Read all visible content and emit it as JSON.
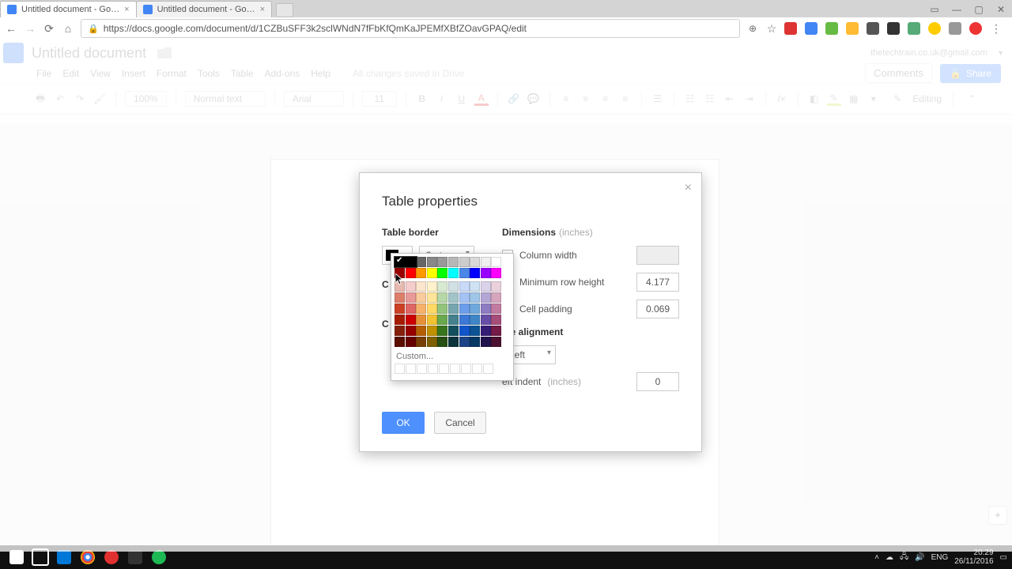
{
  "browser": {
    "tabs": [
      {
        "title": "Untitled document - Go…"
      },
      {
        "title": "Untitled document - Go…"
      }
    ],
    "url": "https://docs.google.com/document/d/1CZBuSFF3k2sclWNdN7fFbKfQmKaJPEMfXBfZOavGPAQ/edit"
  },
  "docs": {
    "title": "Untitled document",
    "account": "thetechtrain.co.uk@gmail.com",
    "comments": "Comments",
    "share": "Share",
    "menus": [
      "File",
      "Edit",
      "View",
      "Insert",
      "Format",
      "Tools",
      "Table",
      "Add-ons",
      "Help"
    ],
    "saved": "All changes saved in Drive",
    "zoom": "100%",
    "style": "Normal text",
    "font": "Arial",
    "size": "11",
    "editing": "Editing"
  },
  "dialog": {
    "title": "Table properties",
    "close": "×",
    "left": {
      "section": "Table border",
      "pt": "3 pt",
      "cell_bg_label_initial": "C",
      "vert_label_initial": "C"
    },
    "right": {
      "section": "Dimensions",
      "hint": "(inches)",
      "col_width": "Column width",
      "min_row": "Minimum row height",
      "min_row_val": "4.177",
      "cell_pad": "Cell padding",
      "cell_pad_val": "0.069",
      "align_section": "ble alignment",
      "align_val": "Left",
      "indent_label": "eft indent",
      "indent_hint": "(inches)",
      "indent_val": "0"
    },
    "ok": "OK",
    "cancel": "Cancel"
  },
  "picker": {
    "custom": "Custom...",
    "colors": {
      "grays": [
        "#000000",
        "#444444",
        "#666666",
        "#888888",
        "#999999",
        "#b7b7b7",
        "#cccccc",
        "#d9d9d9",
        "#efefef",
        "#ffffff"
      ],
      "brights": [
        "#980000",
        "#ff0000",
        "#ff9900",
        "#ffff00",
        "#00ff00",
        "#00ffff",
        "#4a86e8",
        "#0000ff",
        "#9900ff",
        "#ff00ff"
      ],
      "shades": [
        [
          "#e6b8af",
          "#f4cccc",
          "#fce5cd",
          "#fff2cc",
          "#d9ead3",
          "#d0e0e3",
          "#c9daf8",
          "#cfe2f3",
          "#d9d2e9",
          "#ead1dc"
        ],
        [
          "#dd7e6b",
          "#ea9999",
          "#f9cb9c",
          "#ffe599",
          "#b6d7a8",
          "#a2c4c9",
          "#a4c2f4",
          "#9fc5e8",
          "#b4a7d6",
          "#d5a6bd"
        ],
        [
          "#cc4125",
          "#e06666",
          "#f6b26b",
          "#ffd966",
          "#93c47d",
          "#76a5af",
          "#6d9eeb",
          "#6fa8dc",
          "#8e7cc3",
          "#c27ba0"
        ],
        [
          "#a61c00",
          "#cc0000",
          "#e69138",
          "#f1c232",
          "#6aa84f",
          "#45818e",
          "#3c78d8",
          "#3d85c6",
          "#674ea7",
          "#a64d79"
        ],
        [
          "#85200c",
          "#990000",
          "#b45f06",
          "#bf9000",
          "#38761d",
          "#134f5c",
          "#1155cc",
          "#0b5394",
          "#351c75",
          "#741b47"
        ],
        [
          "#5b0f00",
          "#660000",
          "#783f04",
          "#7f6000",
          "#274e13",
          "#0c343d",
          "#1c4587",
          "#073763",
          "#20124d",
          "#4c1130"
        ]
      ]
    }
  },
  "taskbar_time": "20:29",
  "taskbar_date": "26/11/2016",
  "lang": "ENG"
}
